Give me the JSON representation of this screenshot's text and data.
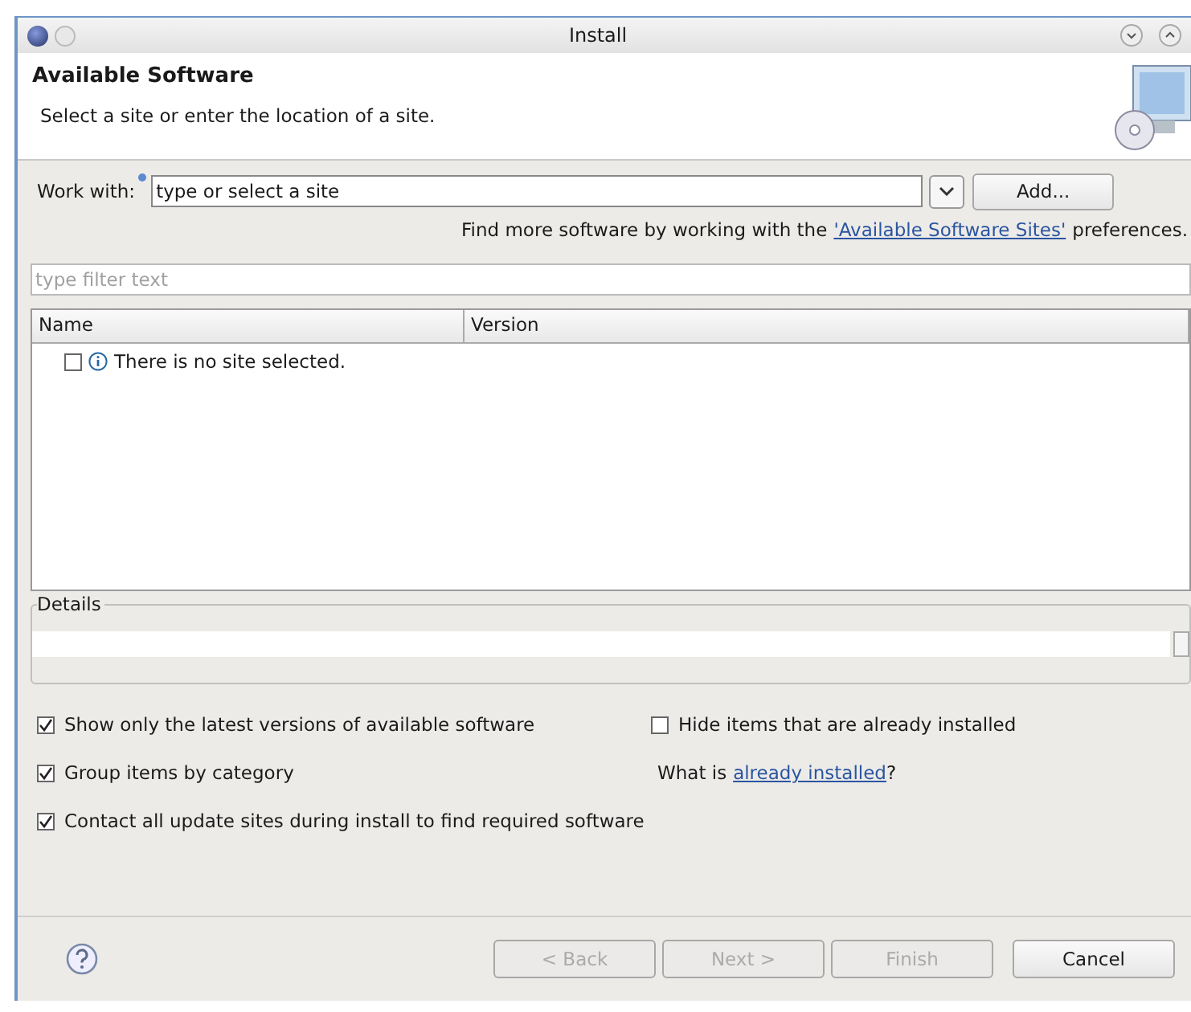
{
  "window": {
    "title": "Install"
  },
  "header": {
    "title": "Available Software",
    "subtitle": "Select a site or enter the location of a site."
  },
  "work_with": {
    "label": "Work with:",
    "placeholder": "type or select a site",
    "add_button": "Add..."
  },
  "sites_note": {
    "before": "Find more software by working with the",
    "link": "'Available Software Sites'",
    "after": "preferences."
  },
  "filter": {
    "placeholder": "type filter text"
  },
  "table": {
    "columns": [
      "Name",
      "Version"
    ],
    "rows": [
      {
        "name": "There is no site selected.",
        "checked": false
      }
    ]
  },
  "details": {
    "label": "Details"
  },
  "options": [
    {
      "label": "Show only the latest versions of available software",
      "checked": true
    },
    {
      "label": "Hide items that are already installed",
      "checked": false
    },
    {
      "label": "Group items by category",
      "checked": true
    },
    {
      "label": "Contact all update sites during install to find required software",
      "checked": true
    }
  ],
  "installed_note": {
    "before": "What is",
    "link": "already installed",
    "after": "?"
  },
  "buttons": [
    {
      "label": "< Back",
      "disabled": true
    },
    {
      "label": "Next >",
      "disabled": true
    },
    {
      "label": "Finish",
      "disabled": true
    },
    {
      "label": "Cancel",
      "disabled": false
    }
  ]
}
